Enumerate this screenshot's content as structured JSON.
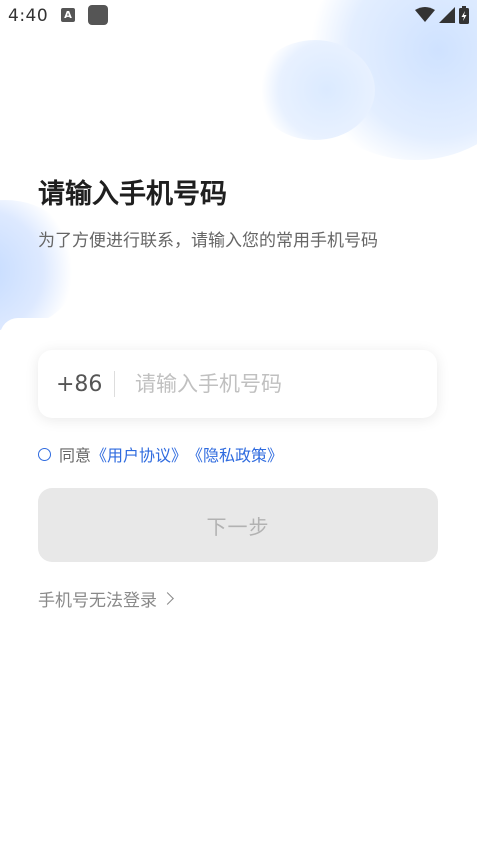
{
  "status_bar": {
    "time": "4:40",
    "a_icon_label": "A"
  },
  "header": {
    "title": "请输入手机号码",
    "subtitle": "为了方便进行联系，请输入您的常用手机号码"
  },
  "phone_input": {
    "country_code": "+86",
    "placeholder": "请输入手机号码",
    "value": ""
  },
  "agreement": {
    "prefix": "同意",
    "user_agreement": "《用户协议》",
    "privacy_policy": "《隐私政策》",
    "checked": false
  },
  "next_button": {
    "label": "下一步",
    "enabled": false
  },
  "cannot_login": {
    "label": "手机号无法登录"
  },
  "colors": {
    "accent": "#2f6bdf",
    "title": "#1f1f1f",
    "subtitle": "#666666",
    "button_disabled_bg": "#e8e8e8",
    "button_disabled_text": "#b2b2b2"
  }
}
